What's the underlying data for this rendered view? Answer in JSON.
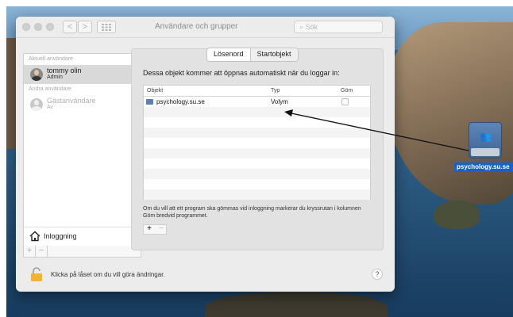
{
  "window": {
    "title": "Användare och grupper",
    "search_placeholder": "Sök",
    "nav_back": "<",
    "nav_forward": ">",
    "grid_icon": "grid-icon"
  },
  "sidebar": {
    "current_user_header": "Aktuell användare",
    "current_user": {
      "name": "tommy olin",
      "role": "Admin"
    },
    "other_users_header": "Andra användare",
    "other_users": [
      {
        "name": "Gästanvändare",
        "role": "Av"
      }
    ],
    "login_label": "Inloggning",
    "add": "+",
    "remove": "−"
  },
  "tabs": [
    {
      "label": "Lösenord",
      "active": true
    },
    {
      "label": "Startobjekt",
      "active": false
    }
  ],
  "startup": {
    "headline": "Dessa objekt kommer att öppnas automatiskt när du loggar in:",
    "columns": [
      "Objekt",
      "Typ",
      "Göm"
    ],
    "rows": [
      {
        "object": "psychology.su.se",
        "type": "Volym",
        "hidden": false
      }
    ],
    "note": "Om du vill att ett program ska gömmas vid inloggning markerar du kryssrutan i kolumnen Göm bredvid programmet.",
    "add": "+",
    "remove": "−"
  },
  "footer": {
    "lock_message": "Klicka på låset om du vill göra ändringar.",
    "help": "?"
  },
  "desktop": {
    "drag_item_label": "psychology.su.se"
  }
}
